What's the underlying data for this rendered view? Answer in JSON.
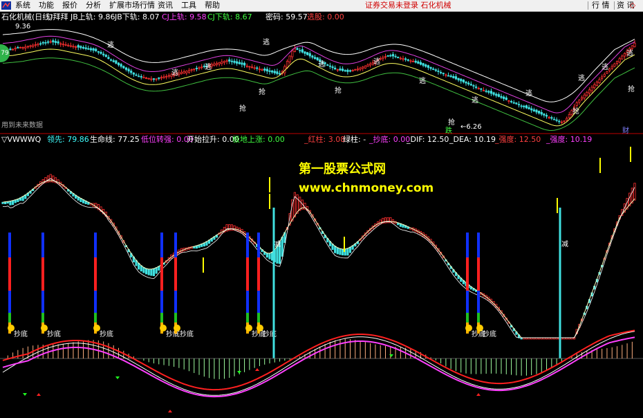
{
  "menubar": {
    "items": [
      "系统",
      "功能",
      "报价",
      "分析",
      "扩展市场行情",
      "资讯",
      "工具",
      "帮助"
    ],
    "status": "证券交易未登录  石化机械",
    "right_buttons": [
      "行 情",
      "资 讯"
    ],
    "window_buttons": [
      "◇",
      "□",
      "✕"
    ]
  },
  "panel1": {
    "title": "石化机械(日线)",
    "indicator": "▽拜拜",
    "fields": [
      {
        "label": "JB上轨: ",
        "value": "9.86",
        "color": "#ffffff"
      },
      {
        "label": "JB下轨: ",
        "value": "8.07",
        "color": "#ffffff"
      },
      {
        "label": "CJ上轨: ",
        "value": "9.58",
        "color": "#ff40ff"
      },
      {
        "label": "CJ下轨: ",
        "value": "8.67",
        "color": "#40ff40"
      },
      {
        "label": "密码: ",
        "value": "59.57",
        "color": "#ffffff"
      },
      {
        "label": "选股: ",
        "value": "0.00",
        "color": "#ff4040"
      }
    ],
    "side_badge": "79",
    "high_label": "9.36",
    "low_label": "6.26",
    "footer_note": "用到未来数据",
    "finance_label": "财",
    "signals": {
      "escape": "逃",
      "grab": "抢",
      "fall": "跌"
    }
  },
  "panel2": {
    "indicator": "▽VWWWQ",
    "fields": [
      {
        "label": "领先: ",
        "value": "79.86",
        "color": "#40ffff"
      },
      {
        "label": "生命线: ",
        "value": "77.25",
        "color": "#ffffff"
      },
      {
        "label": "低位转强: ",
        "value": "0.00",
        "color": "#ff40ff"
      },
      {
        "label": "开始拉升: ",
        "value": "0.00",
        "color": "#ffffff"
      },
      {
        "label": "极地上涨: ",
        "value": "0.00",
        "color": "#40ff40"
      },
      {
        "label": "_红柱: ",
        "value": "3.08",
        "color": "#ff4040"
      },
      {
        "label": "绿柱: ",
        "value": "-",
        "color": "#ffffff"
      },
      {
        "label": "_抄底: ",
        "value": "0.00",
        "color": "#ff40ff"
      },
      {
        "label": "_DIF: ",
        "value": "12.50",
        "color": "#ffffff"
      },
      {
        "label": "_DEA: ",
        "value": "10.19",
        "color": "#ffffff"
      },
      {
        "label": "_强度: ",
        "value": "12.50",
        "color": "#ff4040"
      },
      {
        "label": "_强度: ",
        "value": "10.19",
        "color": "#ff40ff"
      }
    ],
    "watermark_1": "第一股票公式网",
    "watermark_2": "www.chnmoney.com",
    "signals": {
      "bottom": "抄底",
      "reduce": "减"
    }
  },
  "colors": {
    "bg": "#000000",
    "up": "#ff3030",
    "down": "#40e0e0",
    "upper_band": "#ffffff",
    "lower_band": "#40c040",
    "cj_upper": "#e040e0",
    "cj_lower": "#ffff60",
    "signal_yellow": "#ffff00",
    "red_line": "#ff2020",
    "magenta_line": "#ff40ff"
  },
  "chart_data": [
    {
      "type": "candlestick",
      "name": "石化机械(日线)",
      "ylim": [
        6,
        10
      ],
      "close": [
        9.0,
        9.02,
        9.05,
        9.04,
        9.06,
        9.1,
        9.12,
        9.14,
        9.13,
        9.15,
        9.18,
        9.2,
        9.22,
        9.24,
        9.26,
        9.28,
        9.3,
        9.32,
        9.34,
        9.36,
        9.34,
        9.32,
        9.3,
        9.28,
        9.26,
        9.24,
        9.22,
        9.2,
        9.18,
        9.16,
        9.14,
        9.12,
        9.1,
        9.08,
        9.06,
        9.04,
        9.02,
        9.0,
        8.96,
        8.9,
        8.84,
        8.78,
        8.7,
        8.64,
        8.58,
        8.52,
        8.46,
        8.4,
        8.34,
        8.28,
        8.22,
        8.16,
        8.1,
        8.06,
        8.02,
        8.0,
        7.98,
        7.96,
        7.94,
        7.92,
        7.9,
        7.92,
        7.95,
        7.98,
        8.0,
        8.02,
        8.05,
        8.08,
        8.1,
        8.12,
        8.15,
        8.18,
        8.2,
        8.22,
        8.25,
        8.28,
        8.3,
        8.32,
        8.35,
        8.38,
        8.4,
        8.42,
        8.45,
        8.48,
        8.5,
        8.52,
        8.55,
        8.58,
        8.6,
        8.62,
        8.6,
        8.58,
        8.55,
        8.52,
        8.5,
        8.48,
        8.45,
        8.42,
        8.4,
        8.38,
        8.35,
        8.32,
        8.3,
        8.28,
        8.25,
        8.22,
        8.2,
        8.18,
        8.15,
        8.12,
        8.1,
        8.2,
        8.4,
        8.6,
        8.8,
        9.0,
        9.1,
        9.05,
        9.0,
        8.95,
        8.9,
        8.85,
        8.8,
        8.75,
        8.7,
        8.65,
        8.6,
        8.55,
        8.5,
        8.45,
        8.4,
        8.35,
        8.3,
        8.28,
        8.26,
        8.24,
        8.22,
        8.2,
        8.22,
        8.25,
        8.28,
        8.3,
        8.34,
        8.38,
        8.42,
        8.46,
        8.5,
        8.55,
        8.6,
        8.65,
        8.7,
        8.75,
        8.78,
        8.8,
        8.82,
        8.8,
        8.78,
        8.75,
        8.72,
        8.7,
        8.68,
        8.65,
        8.62,
        8.6,
        8.56,
        8.52,
        8.48,
        8.44,
        8.4,
        8.36,
        8.32,
        8.28,
        8.24,
        8.2,
        8.16,
        8.12,
        8.08,
        8.04,
        8.0,
        7.96,
        7.92,
        7.88,
        7.84,
        7.8,
        7.76,
        7.72,
        7.68,
        7.64,
        7.6,
        7.56,
        7.52,
        7.48,
        7.44,
        7.4,
        7.36,
        7.32,
        7.28,
        7.24,
        7.2,
        7.16,
        7.12,
        7.08,
        7.04,
        7.0,
        6.96,
        6.92,
        6.88,
        6.84,
        6.8,
        6.76,
        6.72,
        6.68,
        6.64,
        6.6,
        6.56,
        6.52,
        6.48,
        6.44,
        6.4,
        6.36,
        6.32,
        6.28,
        6.26,
        6.3,
        6.4,
        6.55,
        6.7,
        6.85,
        7.0,
        7.1,
        7.2,
        7.3,
        7.4,
        7.5,
        7.6,
        7.7,
        7.8,
        7.9,
        8.0,
        8.1,
        8.2,
        8.3,
        8.4,
        8.5,
        8.6,
        8.7,
        8.8,
        8.9,
        9.0,
        9.1,
        9.2,
        9.3
      ]
    },
    {
      "type": "bar+line",
      "name": "VWWWQ",
      "lines": [
        "领先",
        "生命线",
        "DIF",
        "DEA"
      ]
    }
  ]
}
